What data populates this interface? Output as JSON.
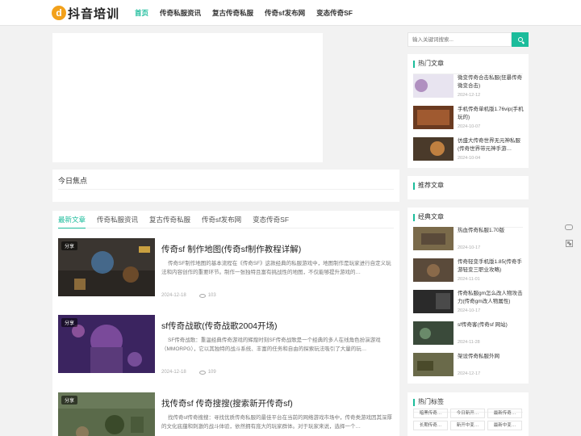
{
  "header": {
    "logo_mark": "d",
    "logo_text": "抖音培训",
    "nav": [
      "首页",
      "传奇私服资讯",
      "复古传奇私服",
      "传奇sf发布网",
      "变态传奇SF"
    ]
  },
  "focus": {
    "title": "今日焦点"
  },
  "tabs": [
    "最新文章",
    "传奇私服资讯",
    "复古传奇私服",
    "传奇sf发布网",
    "变态传奇SF"
  ],
  "articles": [
    {
      "tag": "分享",
      "title": "传奇sf 制作地图(传奇sf制作教程详解)",
      "desc": "传奇SF制作地图的基本流程在《传奇SF》这款经典的私服游戏中，地图制作是玩家进行自定义玩法和内容创作的重要环节。制作一张独特且富有挑战性的地图，不仅能够提升游戏的…",
      "date": "2024-12-18",
      "views": "103"
    },
    {
      "tag": "分享",
      "title": "sf传奇战歌(传奇战歌2004开场)",
      "desc": "SF传奇战歌：重温经典传奇游戏的辉煌时刻SF传奇战歌是一个经典的多人在线角色扮演游戏（MMORPG），它以其独特的战斗系统、丰富的任务和自由的探索玩法吸引了大量的玩…",
      "date": "2024-12-18",
      "views": "109"
    },
    {
      "tag": "分享",
      "title": "找传奇sf 传奇搜搜(搜索新开传奇sf)",
      "desc": "找传奇sf传奇搜搜：寻找优质传奇私服的最佳平台在当前的网络游戏市场中，传奇类游戏因其深厚的文化底蕴和刺激的战斗体验，依然拥有庞大的玩家群体。对于玩家来说，选择一个…",
      "date": "2024-12-18",
      "views": "98"
    }
  ],
  "search": {
    "placeholder": "输入关键词搜索..."
  },
  "hot": {
    "title": "热门文章",
    "items": [
      {
        "text": "微变传奇合击私服(狂暴传奇微变合击)",
        "date": "2024-12-12"
      },
      {
        "text": "手机传奇单机版1.76vip(手机玩的)",
        "date": "2024-10-07"
      },
      {
        "text": "仿盛大传奇世界无元神私服(传奇世界带元神手游…",
        "date": "2024-10-04"
      }
    ]
  },
  "recommend": {
    "title": "推荐文章"
  },
  "classic": {
    "title": "经典文章",
    "items": [
      {
        "text": "热血传奇私服1.70版",
        "date": "2024-10-17"
      },
      {
        "text": "传奇轻变手机版1.85(传奇手游轻变三职业攻略)",
        "date": "2024-11-01"
      },
      {
        "text": "传奇私服gm怎么改人物攻击力(传奇gm改人物属性)",
        "date": "2024-10-17"
      },
      {
        "text": "sf传奇客(传奇sf 网站)",
        "date": "2024-11-28"
      },
      {
        "text": "架设传奇私服外网",
        "date": "2024-12-17"
      }
    ]
  },
  "tags": {
    "title": "热门标签",
    "items": [
      "暗黑传奇…",
      "今日新开…",
      "最新传奇…",
      "长期传奇…",
      "新开中变…",
      "最新中变…"
    ]
  },
  "colors": {
    "accent": "#1bbc9b",
    "logo": "#f2a11b"
  }
}
